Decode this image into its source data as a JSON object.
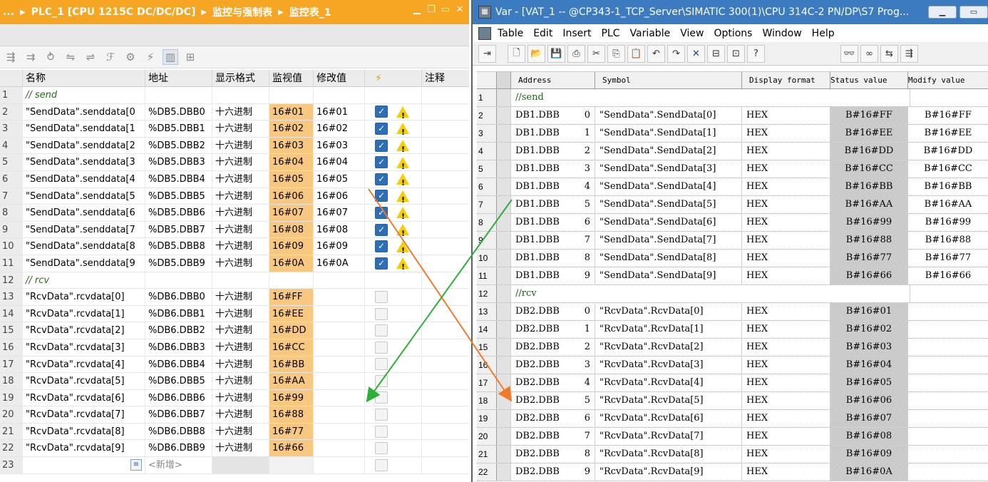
{
  "left": {
    "title_parts": [
      "...",
      "PLC_1 [CPU 1215C DC/DC/DC]",
      "监控与强制表",
      "监控表_1"
    ],
    "columns": [
      "",
      "名称",
      "地址",
      "显示格式",
      "监视值",
      "修改值",
      "⚡",
      "注释"
    ],
    "rows": [
      {
        "idx": "1",
        "name": "// send",
        "section": true
      },
      {
        "idx": "2",
        "name": "\"SendData\".senddata[0",
        "addr": "%DB5.DBB0",
        "fmt": "十六进制",
        "mon": "16#01",
        "mod": "16#01",
        "checked": true,
        "warn": true
      },
      {
        "idx": "3",
        "name": "\"SendData\".senddata[1",
        "addr": "%DB5.DBB1",
        "fmt": "十六进制",
        "mon": "16#02",
        "mod": "16#02",
        "checked": true,
        "warn": true
      },
      {
        "idx": "4",
        "name": "\"SendData\".senddata[2",
        "addr": "%DB5.DBB2",
        "fmt": "十六进制",
        "mon": "16#03",
        "mod": "16#03",
        "checked": true,
        "warn": true
      },
      {
        "idx": "5",
        "name": "\"SendData\".senddata[3",
        "addr": "%DB5.DBB3",
        "fmt": "十六进制",
        "mon": "16#04",
        "mod": "16#04",
        "checked": true,
        "warn": true
      },
      {
        "idx": "6",
        "name": "\"SendData\".senddata[4",
        "addr": "%DB5.DBB4",
        "fmt": "十六进制",
        "mon": "16#05",
        "mod": "16#05",
        "checked": true,
        "warn": true
      },
      {
        "idx": "7",
        "name": "\"SendData\".senddata[5",
        "addr": "%DB5.DBB5",
        "fmt": "十六进制",
        "mon": "16#06",
        "mod": "16#06",
        "checked": true,
        "warn": true
      },
      {
        "idx": "8",
        "name": "\"SendData\".senddata[6",
        "addr": "%DB5.DBB6",
        "fmt": "十六进制",
        "mon": "16#07",
        "mod": "16#07",
        "checked": true,
        "warn": true
      },
      {
        "idx": "9",
        "name": "\"SendData\".senddata[7",
        "addr": "%DB5.DBB7",
        "fmt": "十六进制",
        "mon": "16#08",
        "mod": "16#08",
        "checked": true,
        "warn": true
      },
      {
        "idx": "10",
        "name": "\"SendData\".senddata[8",
        "addr": "%DB5.DBB8",
        "fmt": "十六进制",
        "mon": "16#09",
        "mod": "16#09",
        "checked": true,
        "warn": true
      },
      {
        "idx": "11",
        "name": "\"SendData\".senddata[9",
        "addr": "%DB5.DBB9",
        "fmt": "十六进制",
        "mon": "16#0A",
        "mod": "16#0A",
        "checked": true,
        "warn": true
      },
      {
        "idx": "12",
        "name": "// rcv",
        "section": true
      },
      {
        "idx": "13",
        "name": "\"RcvData\".rcvdata[0]",
        "addr": "%DB6.DBB0",
        "fmt": "十六进制",
        "mon": "16#FF",
        "mod": "",
        "checked": false,
        "warn": false
      },
      {
        "idx": "14",
        "name": "\"RcvData\".rcvdata[1]",
        "addr": "%DB6.DBB1",
        "fmt": "十六进制",
        "mon": "16#EE",
        "mod": "",
        "checked": false,
        "warn": false
      },
      {
        "idx": "15",
        "name": "\"RcvData\".rcvdata[2]",
        "addr": "%DB6.DBB2",
        "fmt": "十六进制",
        "mon": "16#DD",
        "mod": "",
        "checked": false,
        "warn": false
      },
      {
        "idx": "16",
        "name": "\"RcvData\".rcvdata[3]",
        "addr": "%DB6.DBB3",
        "fmt": "十六进制",
        "mon": "16#CC",
        "mod": "",
        "checked": false,
        "warn": false
      },
      {
        "idx": "17",
        "name": "\"RcvData\".rcvdata[4]",
        "addr": "%DB6.DBB4",
        "fmt": "十六进制",
        "mon": "16#BB",
        "mod": "",
        "checked": false,
        "warn": false
      },
      {
        "idx": "18",
        "name": "\"RcvData\".rcvdata[5]",
        "addr": "%DB6.DBB5",
        "fmt": "十六进制",
        "mon": "16#AA",
        "mod": "",
        "checked": false,
        "warn": false
      },
      {
        "idx": "19",
        "name": "\"RcvData\".rcvdata[6]",
        "addr": "%DB6.DBB6",
        "fmt": "十六进制",
        "mon": "16#99",
        "mod": "",
        "checked": false,
        "warn": false
      },
      {
        "idx": "20",
        "name": "\"RcvData\".rcvdata[7]",
        "addr": "%DB6.DBB7",
        "fmt": "十六进制",
        "mon": "16#88",
        "mod": "",
        "checked": false,
        "warn": false
      },
      {
        "idx": "21",
        "name": "\"RcvData\".rcvdata[8]",
        "addr": "%DB6.DBB8",
        "fmt": "十六进制",
        "mon": "16#77",
        "mod": "",
        "checked": false,
        "warn": false
      },
      {
        "idx": "22",
        "name": "\"RcvData\".rcvdata[9]",
        "addr": "%DB6.DBB9",
        "fmt": "十六进制",
        "mon": "16#66",
        "mod": "",
        "checked": false,
        "warn": false
      },
      {
        "idx": "23",
        "name": "",
        "addr": "<新增>",
        "new": true
      }
    ]
  },
  "right": {
    "title": "Var - [VAT_1 -- @CP343-1_TCP_Server\\SIMATIC 300(1)\\CPU 314C-2 PN/DP\\S7 Prog...",
    "menu": [
      "Table",
      "Edit",
      "Insert",
      "PLC",
      "Variable",
      "View",
      "Options",
      "Window",
      "Help"
    ],
    "columns": [
      "",
      "",
      "Address",
      "Symbol",
      "Display format",
      "Status value",
      "Modify value"
    ],
    "rows": [
      {
        "idx": "1",
        "comment": "//send"
      },
      {
        "idx": "2",
        "addr": "DB1.DBB",
        "off": "0",
        "sym": "\"SendData\".SendData[0]",
        "fmt": "HEX",
        "st": "B#16#FF",
        "mod": "B#16#FF"
      },
      {
        "idx": "3",
        "addr": "DB1.DBB",
        "off": "1",
        "sym": "\"SendData\".SendData[1]",
        "fmt": "HEX",
        "st": "B#16#EE",
        "mod": "B#16#EE"
      },
      {
        "idx": "4",
        "addr": "DB1.DBB",
        "off": "2",
        "sym": "\"SendData\".SendData[2]",
        "fmt": "HEX",
        "st": "B#16#DD",
        "mod": "B#16#DD"
      },
      {
        "idx": "5",
        "addr": "DB1.DBB",
        "off": "3",
        "sym": "\"SendData\".SendData[3]",
        "fmt": "HEX",
        "st": "B#16#CC",
        "mod": "B#16#CC"
      },
      {
        "idx": "6",
        "addr": "DB1.DBB",
        "off": "4",
        "sym": "\"SendData\".SendData[4]",
        "fmt": "HEX",
        "st": "B#16#BB",
        "mod": "B#16#BB"
      },
      {
        "idx": "7",
        "addr": "DB1.DBB",
        "off": "5",
        "sym": "\"SendData\".SendData[5]",
        "fmt": "HEX",
        "st": "B#16#AA",
        "mod": "B#16#AA"
      },
      {
        "idx": "8",
        "addr": "DB1.DBB",
        "off": "6",
        "sym": "\"SendData\".SendData[6]",
        "fmt": "HEX",
        "st": "B#16#99",
        "mod": "B#16#99"
      },
      {
        "idx": "9",
        "addr": "DB1.DBB",
        "off": "7",
        "sym": "\"SendData\".SendData[7]",
        "fmt": "HEX",
        "st": "B#16#88",
        "mod": "B#16#88"
      },
      {
        "idx": "10",
        "addr": "DB1.DBB",
        "off": "8",
        "sym": "\"SendData\".SendData[8]",
        "fmt": "HEX",
        "st": "B#16#77",
        "mod": "B#16#77"
      },
      {
        "idx": "11",
        "addr": "DB1.DBB",
        "off": "9",
        "sym": "\"SendData\".SendData[9]",
        "fmt": "HEX",
        "st": "B#16#66",
        "mod": "B#16#66"
      },
      {
        "idx": "12",
        "comment": "//rcv"
      },
      {
        "idx": "13",
        "addr": "DB2.DBB",
        "off": "0",
        "sym": "\"RcvData\".RcvData[0]",
        "fmt": "HEX",
        "st": "B#16#01",
        "mod": ""
      },
      {
        "idx": "14",
        "addr": "DB2.DBB",
        "off": "1",
        "sym": "\"RcvData\".RcvData[1]",
        "fmt": "HEX",
        "st": "B#16#02",
        "mod": ""
      },
      {
        "idx": "15",
        "addr": "DB2.DBB",
        "off": "2",
        "sym": "\"RcvData\".RcvData[2]",
        "fmt": "HEX",
        "st": "B#16#03",
        "mod": ""
      },
      {
        "idx": "16",
        "addr": "DB2.DBB",
        "off": "3",
        "sym": "\"RcvData\".RcvData[3]",
        "fmt": "HEX",
        "st": "B#16#04",
        "mod": ""
      },
      {
        "idx": "17",
        "addr": "DB2.DBB",
        "off": "4",
        "sym": "\"RcvData\".RcvData[4]",
        "fmt": "HEX",
        "st": "B#16#05",
        "mod": ""
      },
      {
        "idx": "18",
        "addr": "DB2.DBB",
        "off": "5",
        "sym": "\"RcvData\".RcvData[5]",
        "fmt": "HEX",
        "st": "B#16#06",
        "mod": ""
      },
      {
        "idx": "19",
        "addr": "DB2.DBB",
        "off": "6",
        "sym": "\"RcvData\".RcvData[6]",
        "fmt": "HEX",
        "st": "B#16#07",
        "mod": ""
      },
      {
        "idx": "20",
        "addr": "DB2.DBB",
        "off": "7",
        "sym": "\"RcvData\".RcvData[7]",
        "fmt": "HEX",
        "st": "B#16#08",
        "mod": ""
      },
      {
        "idx": "21",
        "addr": "DB2.DBB",
        "off": "8",
        "sym": "\"RcvData\".RcvData[8]",
        "fmt": "HEX",
        "st": "B#16#09",
        "mod": ""
      },
      {
        "idx": "22",
        "addr": "DB2.DBB",
        "off": "9",
        "sym": "\"RcvData\".RcvData[9]",
        "fmt": "HEX",
        "st": "B#16#0A",
        "mod": ""
      }
    ]
  },
  "colors": {
    "tia_title_bg": "#f6a623",
    "monitor_cell": "#f8c780",
    "step7_title_bg": "#3c7bbf",
    "status_cell": "#cbcbcb",
    "arrow_orange": "#f07a2a",
    "arrow_green": "#2fae3a"
  },
  "icons": [
    "windows-minimize-icon",
    "windows-restore-icon",
    "windows-close-icon",
    "checkbox-checked-icon",
    "warning-triangle-icon",
    "add-row-icon",
    "new-file-icon",
    "open-folder-icon",
    "save-icon",
    "print-icon",
    "cut-icon",
    "copy-icon",
    "paste-icon",
    "undo-icon",
    "redo-icon",
    "delete-icon",
    "connect-icon",
    "help-icon",
    "monitor-icon",
    "modify-icon"
  ]
}
